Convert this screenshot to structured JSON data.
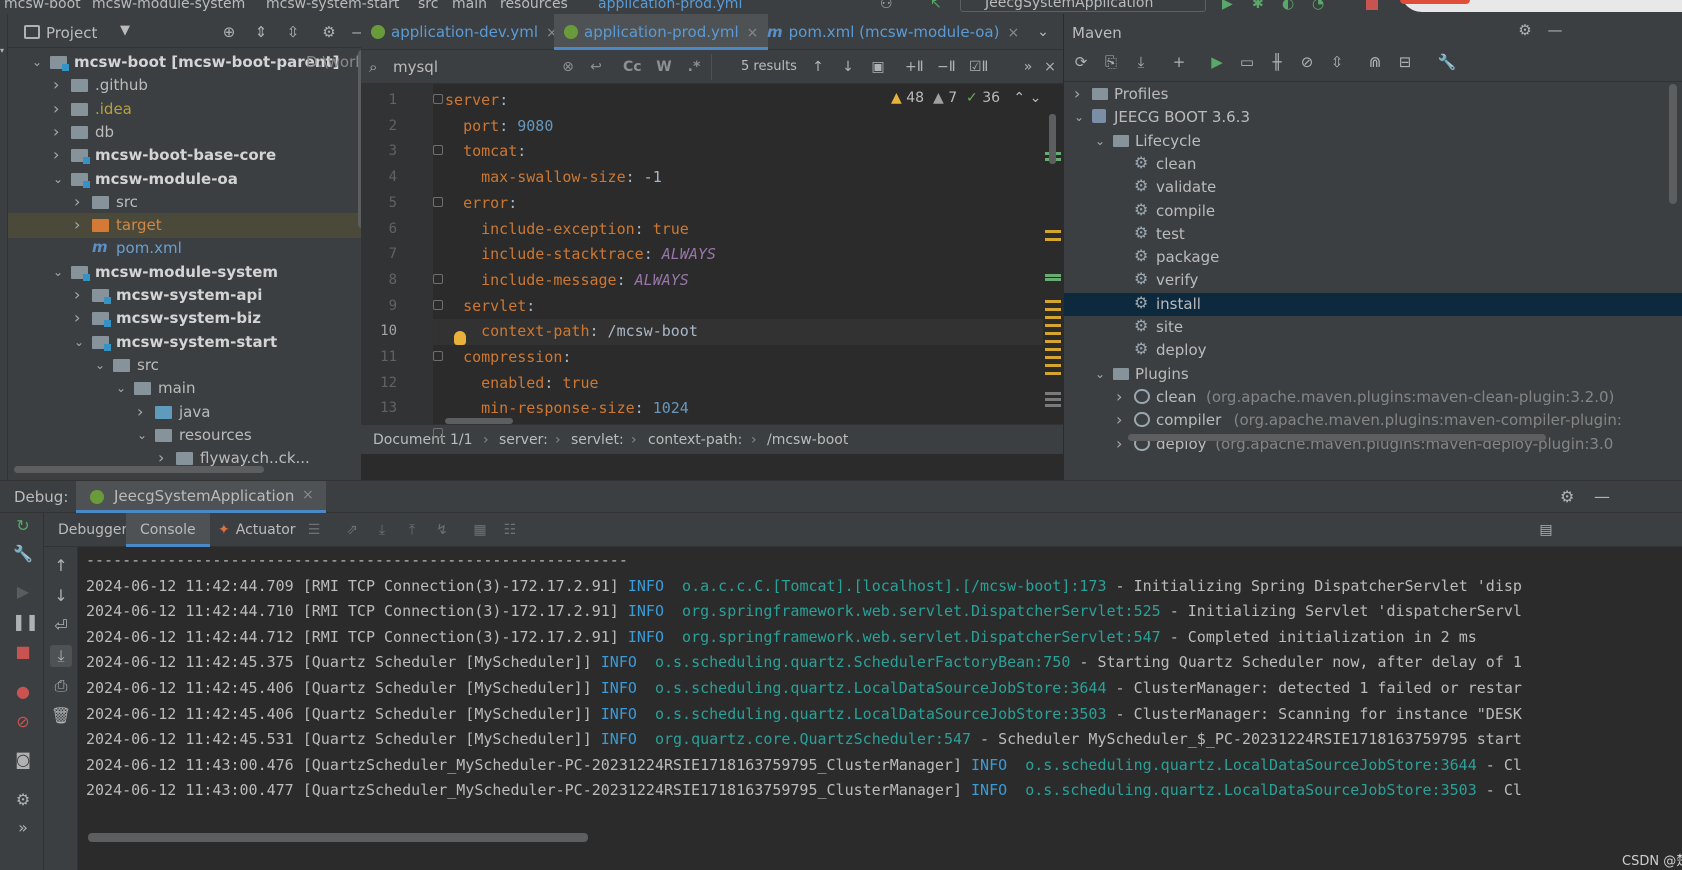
{
  "topbar": {
    "crumbs": [
      "mcsw-boot",
      "mcsw-module-system",
      "mcsw-system-start",
      "src",
      "main",
      "resources",
      "application-prod.yml"
    ],
    "run_config": "JeecgSystemApplication"
  },
  "project": {
    "title": "Project",
    "tree": [
      {
        "label": "mcsw-boot [mcsw-boot-parent]",
        "extra": "D:\\work\\m",
        "depth": 0,
        "arrow": "down",
        "kind": "module"
      },
      {
        "label": ".github",
        "depth": 1,
        "arrow": "right",
        "kind": "folder"
      },
      {
        "label": ".idea",
        "depth": 1,
        "arrow": "right",
        "kind": "folder-idea"
      },
      {
        "label": "db",
        "depth": 1,
        "arrow": "right",
        "kind": "folder"
      },
      {
        "label": "mcsw-boot-base-core",
        "depth": 1,
        "arrow": "right",
        "kind": "module"
      },
      {
        "label": "mcsw-module-oa",
        "depth": 1,
        "arrow": "down",
        "kind": "module"
      },
      {
        "label": "src",
        "depth": 2,
        "arrow": "right",
        "kind": "folder"
      },
      {
        "label": "target",
        "depth": 2,
        "arrow": "right",
        "kind": "target"
      },
      {
        "label": "pom.xml",
        "depth": 2,
        "arrow": "none",
        "kind": "pom"
      },
      {
        "label": "mcsw-module-system",
        "depth": 1,
        "arrow": "down",
        "kind": "module"
      },
      {
        "label": "mcsw-system-api",
        "depth": 2,
        "arrow": "right",
        "kind": "module"
      },
      {
        "label": "mcsw-system-biz",
        "depth": 2,
        "arrow": "right",
        "kind": "module"
      },
      {
        "label": "mcsw-system-start",
        "depth": 2,
        "arrow": "down",
        "kind": "module"
      },
      {
        "label": "src",
        "depth": 3,
        "arrow": "down",
        "kind": "folder"
      },
      {
        "label": "main",
        "depth": 4,
        "arrow": "down",
        "kind": "folder"
      },
      {
        "label": "java",
        "depth": 5,
        "arrow": "right",
        "kind": "folder-src"
      },
      {
        "label": "resources",
        "depth": 5,
        "arrow": "down",
        "kind": "folder-res"
      },
      {
        "label": "flyway.ch..ck...",
        "depth": 6,
        "arrow": "right",
        "kind": "folder"
      }
    ]
  },
  "editor": {
    "tabs": [
      {
        "label": "application-dev.yml",
        "icon": "spring"
      },
      {
        "label": "application-prod.yml",
        "icon": "spring",
        "active": true
      },
      {
        "label": "pom.xml (mcsw-module-oa)",
        "icon": "maven"
      }
    ],
    "find": {
      "query": "mysql",
      "results": "5 results",
      "case_label": "Cc",
      "word_label": "W",
      "regex_label": ".*"
    },
    "inspections": {
      "warnings": "48",
      "weak": "7",
      "ok": "36"
    },
    "current_line": 10,
    "lines": [
      {
        "n": "1",
        "segs": [
          [
            "k",
            "server"
          ],
          [
            "s",
            ":"
          ]
        ]
      },
      {
        "n": "2",
        "segs": [
          [
            "s",
            "  "
          ],
          [
            "k",
            "port"
          ],
          [
            "s",
            ": "
          ],
          [
            "v",
            "9080"
          ]
        ]
      },
      {
        "n": "3",
        "segs": [
          [
            "s",
            "  "
          ],
          [
            "k",
            "tomcat"
          ],
          [
            "s",
            ":"
          ]
        ]
      },
      {
        "n": "4",
        "segs": [
          [
            "s",
            "    "
          ],
          [
            "k",
            "max-swallow-size"
          ],
          [
            "s",
            ": -1"
          ]
        ]
      },
      {
        "n": "5",
        "segs": [
          [
            "s",
            "  "
          ],
          [
            "k",
            "error"
          ],
          [
            "s",
            ":"
          ]
        ]
      },
      {
        "n": "6",
        "segs": [
          [
            "s",
            "    "
          ],
          [
            "k",
            "include-exception"
          ],
          [
            "s",
            ": "
          ],
          [
            "t",
            "true"
          ]
        ]
      },
      {
        "n": "7",
        "segs": [
          [
            "s",
            "    "
          ],
          [
            "k",
            "include-stacktrace"
          ],
          [
            "s",
            ": "
          ],
          [
            "it",
            "ALWAYS"
          ]
        ]
      },
      {
        "n": "8",
        "segs": [
          [
            "s",
            "    "
          ],
          [
            "k",
            "include-message"
          ],
          [
            "s",
            ": "
          ],
          [
            "it",
            "ALWAYS"
          ]
        ]
      },
      {
        "n": "9",
        "segs": [
          [
            "s",
            "  "
          ],
          [
            "k",
            "servlet"
          ],
          [
            "s",
            ":"
          ]
        ]
      },
      {
        "n": "10",
        "segs": [
          [
            "s",
            "    "
          ],
          [
            "k",
            "context-path"
          ],
          [
            "s",
            ": /mcsw-boot"
          ]
        ]
      },
      {
        "n": "11",
        "segs": [
          [
            "s",
            "  "
          ],
          [
            "k",
            "compression"
          ],
          [
            "s",
            ":"
          ]
        ]
      },
      {
        "n": "12",
        "segs": [
          [
            "s",
            "    "
          ],
          [
            "k",
            "enabled"
          ],
          [
            "s",
            ": "
          ],
          [
            "t",
            "true"
          ]
        ]
      },
      {
        "n": "13",
        "segs": [
          [
            "s",
            "    "
          ],
          [
            "k",
            "min-response-size"
          ],
          [
            "s",
            ": "
          ],
          [
            "v",
            "1024"
          ]
        ]
      }
    ],
    "breadcrumbs": [
      "Document 1/1",
      "server:",
      "servlet:",
      "context-path:",
      "/mcsw-boot"
    ]
  },
  "maven": {
    "title": "Maven",
    "tree": [
      {
        "label": "Profiles",
        "depth": 0,
        "arrow": "right",
        "kind": "folder"
      },
      {
        "label": "JEECG BOOT 3.6.3",
        "depth": 0,
        "arrow": "down",
        "kind": "mvn"
      },
      {
        "label": "Lifecycle",
        "depth": 1,
        "arrow": "down",
        "kind": "folder"
      },
      {
        "label": "clean",
        "depth": 2,
        "arrow": "none",
        "kind": "gear"
      },
      {
        "label": "validate",
        "depth": 2,
        "arrow": "none",
        "kind": "gear"
      },
      {
        "label": "compile",
        "depth": 2,
        "arrow": "none",
        "kind": "gear"
      },
      {
        "label": "test",
        "depth": 2,
        "arrow": "none",
        "kind": "gear"
      },
      {
        "label": "package",
        "depth": 2,
        "arrow": "none",
        "kind": "gear"
      },
      {
        "label": "verify",
        "depth": 2,
        "arrow": "none",
        "kind": "gear"
      },
      {
        "label": "install",
        "depth": 2,
        "arrow": "none",
        "kind": "gear",
        "selected": true
      },
      {
        "label": "site",
        "depth": 2,
        "arrow": "none",
        "kind": "gear"
      },
      {
        "label": "deploy",
        "depth": 2,
        "arrow": "none",
        "kind": "gear"
      },
      {
        "label": "Plugins",
        "depth": 1,
        "arrow": "down",
        "kind": "folder"
      },
      {
        "label": "clean",
        "extra": "(org.apache.maven.plugins:maven-clean-plugin:3.2.0)",
        "depth": 2,
        "arrow": "right",
        "kind": "plugin"
      },
      {
        "label": "compiler",
        "extra": "(org.apache.maven.plugins:maven-compiler-plugin:",
        "depth": 2,
        "arrow": "right",
        "kind": "plugin"
      },
      {
        "label": "deploy",
        "extra": "(org.apache.maven.plugins:maven-deploy-plugin:3.0",
        "depth": 2,
        "arrow": "right",
        "kind": "plugin"
      }
    ]
  },
  "debug": {
    "label": "Debug:",
    "session": "JeecgSystemApplication",
    "subtabs": [
      "Debugger",
      "Console",
      "Actuator"
    ],
    "console": [
      {
        "plain": "------------------------------------------------------------"
      },
      {
        "ts": "2024-06-12 11:42:44.709",
        "thread": "[RMI TCP Connection(3)-172.17.2.91]",
        "level": "INFO ",
        "cls": "o.a.c.c.C.[Tomcat].[localhost].[/mcsw-boot]:173",
        "msg": " - Initializing Spring DispatcherServlet 'disp"
      },
      {
        "ts": "2024-06-12 11:42:44.710",
        "thread": "[RMI TCP Connection(3)-172.17.2.91]",
        "level": "INFO ",
        "cls": "org.springframework.web.servlet.DispatcherServlet:525",
        "msg": " - Initializing Servlet 'dispatcherServl"
      },
      {
        "ts": "2024-06-12 11:42:44.712",
        "thread": "[RMI TCP Connection(3)-172.17.2.91]",
        "level": "INFO ",
        "cls": "org.springframework.web.servlet.DispatcherServlet:547",
        "msg": " - Completed initialization in 2 ms"
      },
      {
        "ts": "2024-06-12 11:42:45.375",
        "thread": "[Quartz Scheduler [MyScheduler]]",
        "level": "INFO ",
        "cls": "o.s.scheduling.quartz.SchedulerFactoryBean:750",
        "msg": " - Starting Quartz Scheduler now, after delay of 1"
      },
      {
        "ts": "2024-06-12 11:42:45.406",
        "thread": "[Quartz Scheduler [MyScheduler]]",
        "level": "INFO ",
        "cls": "o.s.scheduling.quartz.LocalDataSourceJobStore:3644",
        "msg": " - ClusterManager: detected 1 failed or restar"
      },
      {
        "ts": "2024-06-12 11:42:45.406",
        "thread": "[Quartz Scheduler [MyScheduler]]",
        "level": "INFO ",
        "cls": "o.s.scheduling.quartz.LocalDataSourceJobStore:3503",
        "msg": " - ClusterManager: Scanning for instance \"DESK"
      },
      {
        "ts": "2024-06-12 11:42:45.531",
        "thread": "[Quartz Scheduler [MyScheduler]]",
        "level": "INFO ",
        "cls": "org.quartz.core.QuartzScheduler:547",
        "msg": " - Scheduler MyScheduler_$_PC-20231224RSIE1718163759795 start"
      },
      {
        "ts": "2024-06-12 11:43:00.476",
        "thread": "[QuartzScheduler_MyScheduler-PC-20231224RSIE1718163759795_ClusterManager]",
        "level": "INFO ",
        "cls": "o.s.scheduling.quartz.LocalDataSourceJobStore:3644",
        "msg": " - Cl"
      },
      {
        "ts": "2024-06-12 11:43:00.477",
        "thread": "[QuartzScheduler_MyScheduler-PC-20231224RSIE1718163759795_ClusterManager]",
        "level": "INFO ",
        "cls": "o.s.scheduling.quartz.LocalDataSourceJobStore:3503",
        "msg": " - Cl"
      }
    ]
  },
  "watermark": "CSDN @楚疏笃"
}
